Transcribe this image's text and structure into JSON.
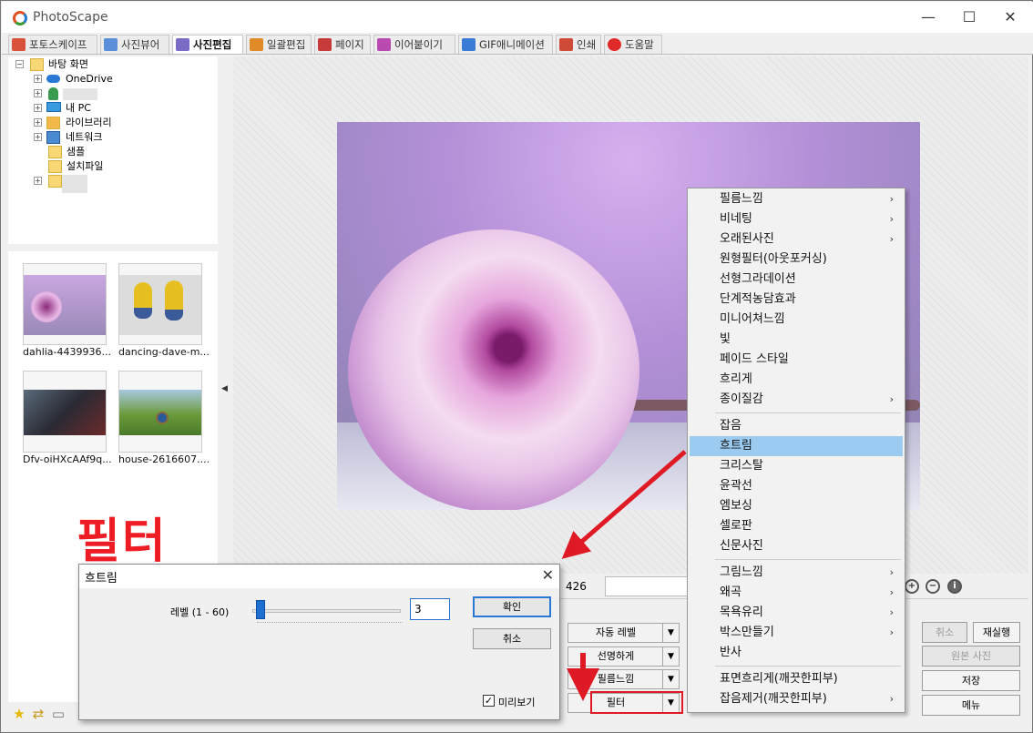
{
  "app": {
    "title": "PhotoScape",
    "minimize": "—",
    "maximize": "☐",
    "close": "✕"
  },
  "tabs": [
    {
      "label": "포토스케이프",
      "color": "#d9533b"
    },
    {
      "label": "사진뷰어",
      "color": "#5b8fd9"
    },
    {
      "label": "사진편집",
      "color": "#7a6cc6",
      "active": true
    },
    {
      "label": "일괄편집",
      "color": "#e08a28"
    },
    {
      "label": "페이지",
      "color": "#c63a3a"
    },
    {
      "label": "이어붙이기",
      "color": "#b84ab0"
    },
    {
      "label": "GIF애니메이션",
      "color": "#3a7bd5"
    },
    {
      "label": "인쇄",
      "color": "#d04a3a"
    },
    {
      "label": "도움말",
      "color": "#e02a2a"
    }
  ],
  "tree": [
    {
      "label": "바탕 화면",
      "expander": "−"
    },
    {
      "label": "OneDrive",
      "expander": "+"
    },
    {
      "label": "",
      "expander": "+"
    },
    {
      "label": "내 PC",
      "expander": "+"
    },
    {
      "label": "라이브러리",
      "expander": "+"
    },
    {
      "label": "네트워크",
      "expander": "+"
    },
    {
      "label": "샘플",
      "expander": ""
    },
    {
      "label": "설치파일",
      "expander": ""
    },
    {
      "label": "",
      "expander": "+"
    }
  ],
  "thumbnails": [
    {
      "caption": "dahlia-4439936...",
      "colors": [
        "#c9a6e0",
        "#9a8ab8"
      ]
    },
    {
      "caption": "dancing-dave-m...",
      "colors": [
        "#d8d8d8",
        "#e6c020"
      ]
    },
    {
      "caption": "Dfv-oiHXcAAf9q...",
      "colors": [
        "#3a3a44",
        "#8a2a2a"
      ]
    },
    {
      "caption": "house-2616607....",
      "colors": [
        "#7a9a3a",
        "#2a5a8a"
      ]
    }
  ],
  "callout": "필터",
  "info": {
    "height": "426"
  },
  "panel_buttons": {
    "auto_level": "자동 레벨",
    "sharpen": "선명하게",
    "film": "필름느낌",
    "filter": "필터"
  },
  "right_buttons": {
    "undo": "취소",
    "redo": "재실행",
    "original": "원본 사진",
    "save": "저장",
    "menu": "메뉴"
  },
  "filter_menu": {
    "group1": [
      {
        "label": "필름느낌",
        "sub": true
      },
      {
        "label": "비네팅",
        "sub": true
      },
      {
        "label": "오래된사진",
        "sub": true
      },
      {
        "label": "원형필터(아웃포커싱)",
        "sub": false
      },
      {
        "label": "선형그라데이션",
        "sub": false
      },
      {
        "label": "단계적농담효과",
        "sub": false
      },
      {
        "label": "미니어쳐느낌",
        "sub": false
      },
      {
        "label": "빛",
        "sub": false
      },
      {
        "label": "페이드 스타일",
        "sub": false
      },
      {
        "label": "흐리게",
        "sub": false
      },
      {
        "label": "종이질감",
        "sub": true
      }
    ],
    "group2": [
      {
        "label": "잡음",
        "sub": false
      },
      {
        "label": "흐트림",
        "sub": false,
        "highlighted": true
      },
      {
        "label": "크리스탈",
        "sub": false
      },
      {
        "label": "윤곽선",
        "sub": false
      },
      {
        "label": "엠보싱",
        "sub": false
      },
      {
        "label": "셀로판",
        "sub": false
      },
      {
        "label": "신문사진",
        "sub": false
      }
    ],
    "group3": [
      {
        "label": "그림느낌",
        "sub": true
      },
      {
        "label": "왜곡",
        "sub": true
      },
      {
        "label": "목욕유리",
        "sub": true
      },
      {
        "label": "박스만들기",
        "sub": true
      },
      {
        "label": "반사",
        "sub": false
      }
    ],
    "group4": [
      {
        "label": "표면흐리게(깨끗한피부)",
        "sub": false
      },
      {
        "label": "잡음제거(깨끗한피부)",
        "sub": true
      }
    ],
    "submenu_glyph": "›"
  },
  "dialog": {
    "title": "흐트림",
    "level_label": "레벨 (1 - 60)",
    "level_value": "3",
    "level_fraction": 0.04,
    "ok": "확인",
    "cancel": "취소",
    "preview_label": "미리보기",
    "preview_checked": true,
    "close_glyph": "✕",
    "check_glyph": "✓"
  },
  "colors": {
    "accent_red": "#e01a24",
    "highlight": "#9ccbf2",
    "slider": "#1e6fcf"
  }
}
